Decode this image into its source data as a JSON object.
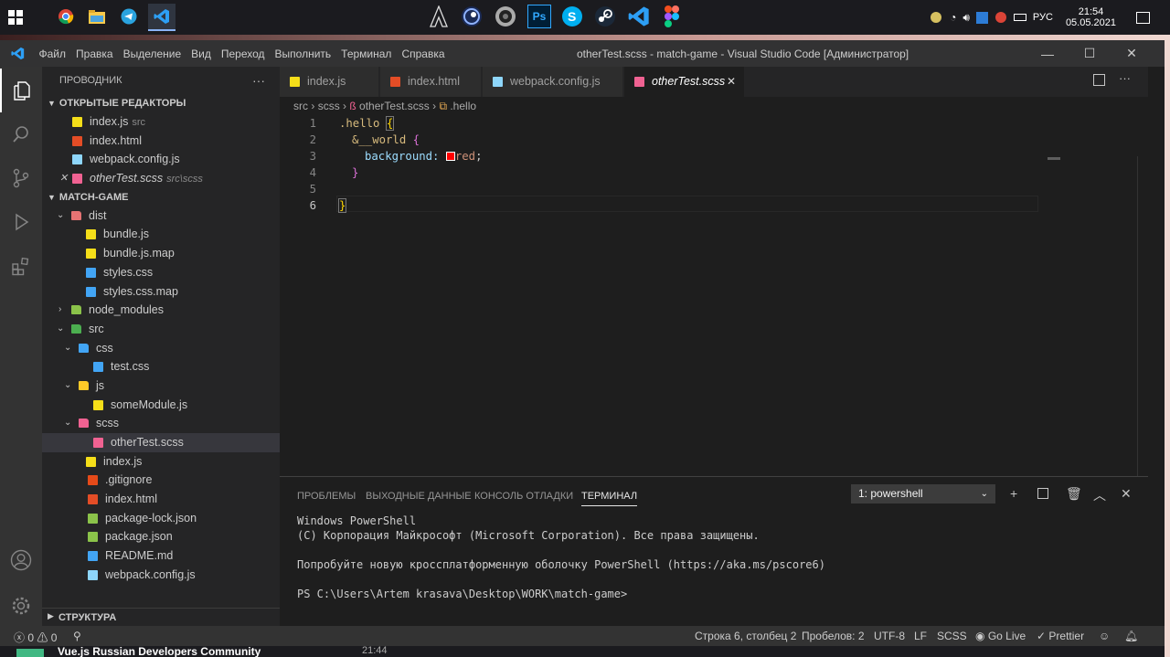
{
  "taskbar": {
    "apps": [
      "windows-start",
      "chrome-icon",
      "explorer-icon",
      "telegram-icon",
      "vscode-icon",
      "assassins-icon",
      "cinema4d-icon",
      "audio-icon",
      "photoshop-icon",
      "skype-icon",
      "steam-icon",
      "vscode-icon",
      "figma-icon"
    ],
    "photoshop_label": "Ps",
    "lang": "РУС",
    "time": "21:54",
    "date": "05.05.2021"
  },
  "titlebar": {
    "menu": [
      "Файл",
      "Правка",
      "Выделение",
      "Вид",
      "Переход",
      "Выполнить",
      "Терминал",
      "Справка"
    ],
    "title": "otherTest.scss - match-game - Visual Studio Code [Администратор]"
  },
  "sidebar": {
    "header": "ПРОВОДНИК",
    "more": "···",
    "open_editors_title": "ОТКРЫТЫЕ РЕДАКТОРЫ",
    "open_editors": [
      {
        "name": "index.js",
        "desc": "src",
        "icon": "js"
      },
      {
        "name": "index.html",
        "desc": "",
        "icon": "html"
      },
      {
        "name": "webpack.config.js",
        "desc": "",
        "icon": "webpack"
      },
      {
        "name": "otherTest.scss",
        "desc": "src\\scss",
        "icon": "scss"
      }
    ],
    "project_title": "MATCH-GAME",
    "tree": [
      {
        "name": "dist",
        "type": "folder-open",
        "icon": "folder-dist"
      },
      {
        "name": "bundle.js",
        "type": "file",
        "icon": "js"
      },
      {
        "name": "bundle.js.map",
        "type": "file",
        "icon": "map"
      },
      {
        "name": "styles.css",
        "type": "file",
        "icon": "css"
      },
      {
        "name": "styles.css.map",
        "type": "file",
        "icon": "css"
      },
      {
        "name": "node_modules",
        "type": "folder-closed",
        "icon": "folder-node"
      },
      {
        "name": "src",
        "type": "folder-open",
        "icon": "folder-src"
      },
      {
        "name": "css",
        "type": "folder-open",
        "icon": "folder-css"
      },
      {
        "name": "test.css",
        "type": "file",
        "icon": "css"
      },
      {
        "name": "js",
        "type": "folder-open",
        "icon": "folder-js"
      },
      {
        "name": "someModule.js",
        "type": "file",
        "icon": "js"
      },
      {
        "name": "scss",
        "type": "folder-open",
        "icon": "folder-scss"
      },
      {
        "name": "otherTest.scss",
        "type": "file",
        "icon": "scss"
      },
      {
        "name": "index.js",
        "type": "file",
        "icon": "js"
      },
      {
        "name": ".gitignore",
        "type": "file",
        "icon": "git"
      },
      {
        "name": "index.html",
        "type": "file",
        "icon": "html"
      },
      {
        "name": "package-lock.json",
        "type": "file",
        "icon": "node"
      },
      {
        "name": "package.json",
        "type": "file",
        "icon": "node"
      },
      {
        "name": "README.md",
        "type": "file",
        "icon": "info"
      },
      {
        "name": "webpack.config.js",
        "type": "file",
        "icon": "webpack"
      }
    ],
    "structure_title": "СТРУКТУРА"
  },
  "tabs": [
    {
      "label": "index.js",
      "icon": "js"
    },
    {
      "label": "index.html",
      "icon": "html"
    },
    {
      "label": "webpack.config.js",
      "icon": "webpack"
    },
    {
      "label": "otherTest.scss",
      "icon": "scss",
      "close": "✕"
    }
  ],
  "breadcrumb": {
    "a": "src",
    "b": "scss",
    "c": "otherTest.scss",
    "d": ".hello"
  },
  "code": {
    "line_numbers": [
      "1",
      "2",
      "3",
      "4",
      "5",
      "6"
    ],
    "l1_sel": ".hello",
    "l1_brace": "{",
    "l2_amp": "&",
    "l2_sel": "__world",
    "l2_brace": "{",
    "l3_prop": "background:",
    "l3_val": "red",
    "l3_semi": ";",
    "l4_brace": "}",
    "l6_brace": "}",
    "swatch_color": "#ff0000"
  },
  "panel": {
    "tabs": [
      "ПРОБЛЕМЫ",
      "ВЫХОДНЫЕ ДАННЫЕ",
      "КОНСОЛЬ ОТЛАДКИ",
      "ТЕРМИНАЛ"
    ],
    "terminal_select": "1: powershell",
    "lines": [
      "Windows PowerShell",
      "(С) Корпорация Майкрософт (Microsoft Corporation). Все права защищены.",
      "Попробуйте новую кроссплатформенную оболочку PowerShell (https://aka.ms/pscore6)",
      "PS C:\\Users\\Artem krasava\\Desktop\\WORK\\match-game>"
    ]
  },
  "statusbar": {
    "errors": "0",
    "warnings": "0",
    "position": "Строка 6, столбец 2",
    "spaces": "Пробелов: 2",
    "encoding": "UTF-8",
    "eol": "LF",
    "language": "SCSS",
    "golive": "Go Live",
    "prettier": "Prettier"
  },
  "bottom": {
    "community": "Vue.js Russian Developers Community",
    "time": "21:44"
  },
  "colors": {
    "accent": "#007acc",
    "js": "#f5de19",
    "html": "#e44d26",
    "css": "#42a5f5",
    "scss": "#f06292",
    "webpack": "#8ed6fb",
    "node": "#8bc34a",
    "keyword": "#d7ba7d",
    "prop": "#9cdcfe",
    "amp": "#c586c0",
    "value": "#ce9178"
  }
}
